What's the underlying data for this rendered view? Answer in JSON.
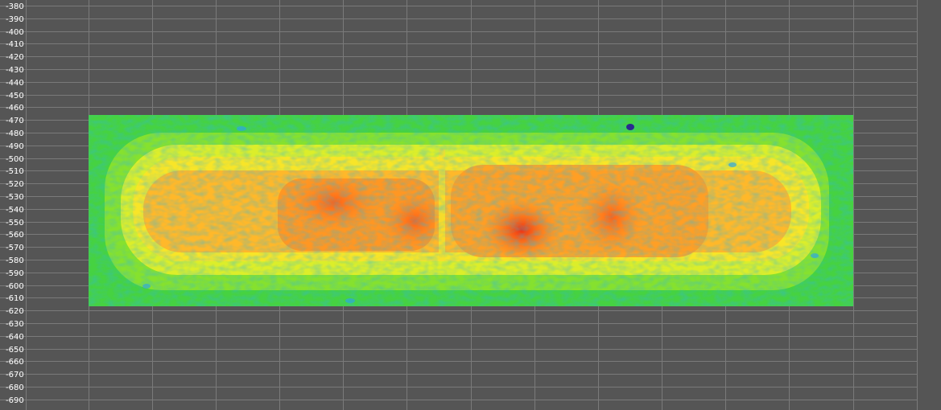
{
  "chart_data": {
    "type": "heatmap",
    "title": "",
    "xlabel": "",
    "ylabel": "",
    "grid": true,
    "ylim": [
      -695,
      -375
    ],
    "y_tick_labels": [
      "-380",
      "-390",
      "-400",
      "-410",
      "-420",
      "-430",
      "-440",
      "-450",
      "-460",
      "-470",
      "-480",
      "-490",
      "-500",
      "-510",
      "-520",
      "-530",
      "-540",
      "-550",
      "-560",
      "-570",
      "-580",
      "-590",
      "-600",
      "-610",
      "-620",
      "-630",
      "-640",
      "-650",
      "-660",
      "-670",
      "-680",
      "-690"
    ],
    "heatmap_extent_y": [
      -615,
      -465
    ],
    "colormap": [
      "#2f2fa0",
      "#2f9be0",
      "#3fd24a",
      "#9ee628",
      "#f2f228",
      "#ffb22a",
      "#ff6a1a",
      "#ee1a10"
    ],
    "colors": {
      "background": "#555555",
      "grid": "#7a7a7a",
      "tick_label": "#ffffff"
    }
  }
}
